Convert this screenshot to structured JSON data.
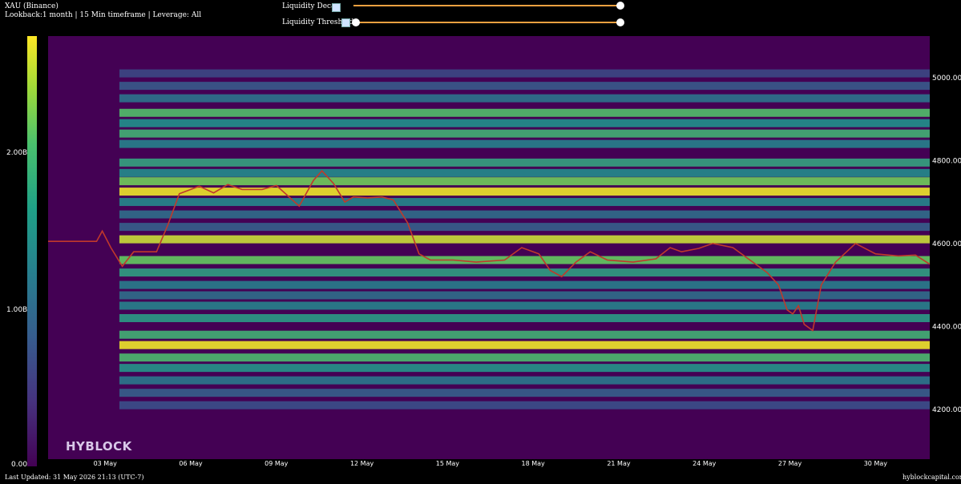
{
  "header": {
    "title": "XAU (Binance)",
    "subtitle": "Lookback:1 month | 15 Min timeframe | Leverage: All"
  },
  "controls": {
    "decay_label": "Liquidity Decay",
    "threshold_label": "Liquidity Threshold",
    "decay_value": 1.0,
    "threshold_min": 0.0,
    "threshold_max": 1.0,
    "icon": "image-icon"
  },
  "colorbar": {
    "labels": [
      "2.00B",
      "1.00B",
      "0.00"
    ],
    "colors": [
      "#440154",
      "#3b528b",
      "#21918c",
      "#5ec962",
      "#fde725"
    ]
  },
  "chart_data": {
    "type": "heatmap",
    "title": "",
    "x_ticks": [
      "03 May",
      "06 May",
      "09 May",
      "12 May",
      "15 May",
      "18 May",
      "21 May",
      "24 May",
      "27 May",
      "30 May"
    ],
    "y_ticks": [
      "5000.00",
      "4800.00",
      "4600.00",
      "4400.00",
      "4200.00"
    ],
    "y_range": [
      4080,
      5100
    ],
    "x_range_days": [
      1.0,
      31.9
    ],
    "colorbar_range": [
      0,
      2.5
    ],
    "colorbar_unit": "B",
    "price_series": {
      "x": [
        1.0,
        2.7,
        2.9,
        3.2,
        3.6,
        4.0,
        4.8,
        5.2,
        5.6,
        6.3,
        6.8,
        7.3,
        7.8,
        8.5,
        9.0,
        9.8,
        10.3,
        10.6,
        11.0,
        11.4,
        11.7,
        12.2,
        12.7,
        13.1,
        13.6,
        14.0,
        14.4,
        14.8,
        15.2,
        16.0,
        17.0,
        17.6,
        18.2,
        18.6,
        19.0,
        19.5,
        20.0,
        20.6,
        21.5,
        22.3,
        22.8,
        23.2,
        23.8,
        24.3,
        25.0,
        25.6,
        26.2,
        26.6,
        26.9,
        27.1,
        27.3,
        27.5,
        27.8,
        28.1,
        28.6,
        29.3,
        30.0,
        30.8,
        31.4,
        31.9
      ],
      "y": [
        4605,
        4605,
        4630,
        4590,
        4545,
        4580,
        4580,
        4645,
        4720,
        4738,
        4722,
        4742,
        4730,
        4730,
        4740,
        4690,
        4752,
        4775,
        4745,
        4700,
        4712,
        4710,
        4712,
        4705,
        4650,
        4575,
        4560,
        4560,
        4560,
        4555,
        4560,
        4590,
        4575,
        4535,
        4520,
        4555,
        4580,
        4560,
        4555,
        4563,
        4590,
        4580,
        4588,
        4600,
        4590,
        4560,
        4530,
        4500,
        4440,
        4430,
        4450,
        4405,
        4390,
        4500,
        4555,
        4600,
        4575,
        4570,
        4572,
        4550
      ]
    },
    "liquidity_bands": [
      {
        "price": 5010,
        "value": 0.55
      },
      {
        "price": 4980,
        "value": 0.7
      },
      {
        "price": 4950,
        "value": 0.95
      },
      {
        "price": 4915,
        "value": 1.75
      },
      {
        "price": 4890,
        "value": 1.25
      },
      {
        "price": 4865,
        "value": 1.6
      },
      {
        "price": 4840,
        "value": 1.1
      },
      {
        "price": 4795,
        "value": 1.45
      },
      {
        "price": 4770,
        "value": 1.2
      },
      {
        "price": 4750,
        "value": 1.95
      },
      {
        "price": 4725,
        "value": 2.45
      },
      {
        "price": 4700,
        "value": 1.15
      },
      {
        "price": 4670,
        "value": 0.9
      },
      {
        "price": 4640,
        "value": 0.75
      },
      {
        "price": 4610,
        "value": 2.3
      },
      {
        "price": 4560,
        "value": 1.9
      },
      {
        "price": 4530,
        "value": 1.4
      },
      {
        "price": 4500,
        "value": 1.05
      },
      {
        "price": 4475,
        "value": 0.9
      },
      {
        "price": 4450,
        "value": 1.1
      },
      {
        "price": 4420,
        "value": 1.35
      },
      {
        "price": 4380,
        "value": 1.6
      },
      {
        "price": 4355,
        "value": 2.45
      },
      {
        "price": 4325,
        "value": 1.7
      },
      {
        "price": 4300,
        "value": 1.3
      },
      {
        "price": 4270,
        "value": 1.0
      },
      {
        "price": 4240,
        "value": 0.75
      },
      {
        "price": 4210,
        "value": 0.6
      }
    ]
  },
  "footer": {
    "updated": "Last Updated: 31 May 2026 21:13 (UTC-7)",
    "site": "hyblockcapital.com",
    "brand": "HYBLOCK"
  }
}
